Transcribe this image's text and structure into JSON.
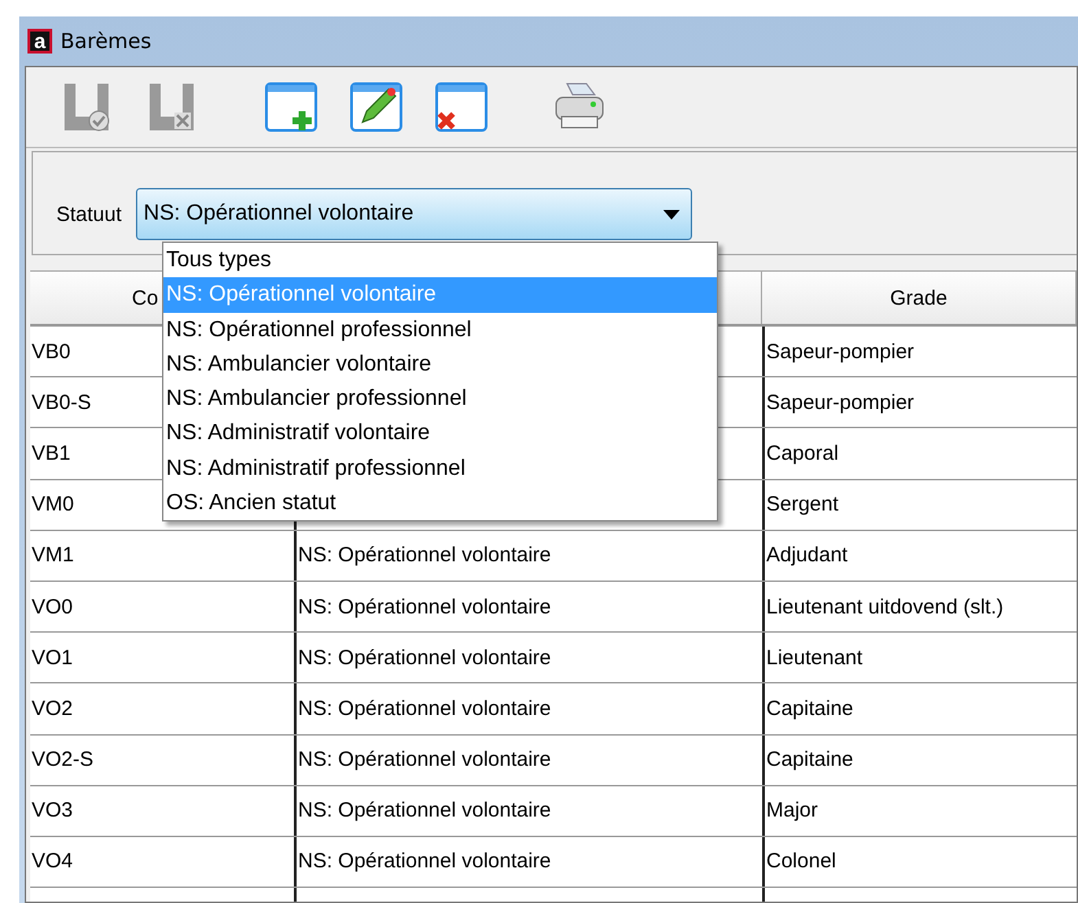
{
  "window": {
    "logo": "a",
    "title": "Barèmes"
  },
  "toolbar": [
    {
      "kind": "save-check",
      "disabled": true
    },
    {
      "kind": "save-cancel",
      "disabled": true
    },
    {
      "kind": "new",
      "disabled": false
    },
    {
      "kind": "edit",
      "disabled": false
    },
    {
      "kind": "delete",
      "disabled": false
    },
    {
      "kind": "print",
      "disabled": false
    }
  ],
  "filter": {
    "label": "Statuut",
    "value": "NS: Opérationnel volontaire",
    "expanded": true,
    "options": [
      {
        "label": "Tous types",
        "selected": false
      },
      {
        "label": "NS: Opérationnel volontaire",
        "selected": true
      },
      {
        "label": "NS: Opérationnel professionnel",
        "selected": false
      },
      {
        "label": "NS: Ambulancier volontaire",
        "selected": false
      },
      {
        "label": "NS: Ambulancier professionnel",
        "selected": false
      },
      {
        "label": "NS: Administratif volontaire",
        "selected": false
      },
      {
        "label": "NS: Administratif professionnel",
        "selected": false
      },
      {
        "label": "OS: Ancien statut",
        "selected": false
      }
    ]
  },
  "table": {
    "header": {
      "column_1": "Co",
      "column_3": "Grade"
    },
    "rows": [
      {
        "column_1": "VB0",
        "column_3": "Sapeur-pompier"
      },
      {
        "column_1": "VB0-S",
        "column_3": "Sapeur-pompier"
      },
      {
        "column_1": "VB1",
        "column_3": "Caporal"
      },
      {
        "column_1": "VM0",
        "column_3": "Sergent"
      },
      {
        "column_1": "VM1",
        "column_2": "NS: Opérationnel volontaire",
        "column_3": "Adjudant"
      },
      {
        "column_1": "VO0",
        "column_2": "NS: Opérationnel volontaire",
        "column_3": "Lieutenant uitdovend (slt.)"
      },
      {
        "column_1": "VO1",
        "column_2": "NS: Opérationnel volontaire",
        "column_3": "Lieutenant"
      },
      {
        "column_1": "VO2",
        "column_2": "NS: Opérationnel volontaire",
        "column_3": "Capitaine"
      },
      {
        "column_1": "VO2-S",
        "column_2": "NS: Opérationnel volontaire",
        "column_3": "Capitaine"
      },
      {
        "column_1": "VO3",
        "column_2": "NS: Opérationnel volontaire",
        "column_3": "Major"
      },
      {
        "column_1": "VO4",
        "column_2": "NS: Opérationnel volontaire",
        "column_3": "Colonel"
      }
    ]
  }
}
